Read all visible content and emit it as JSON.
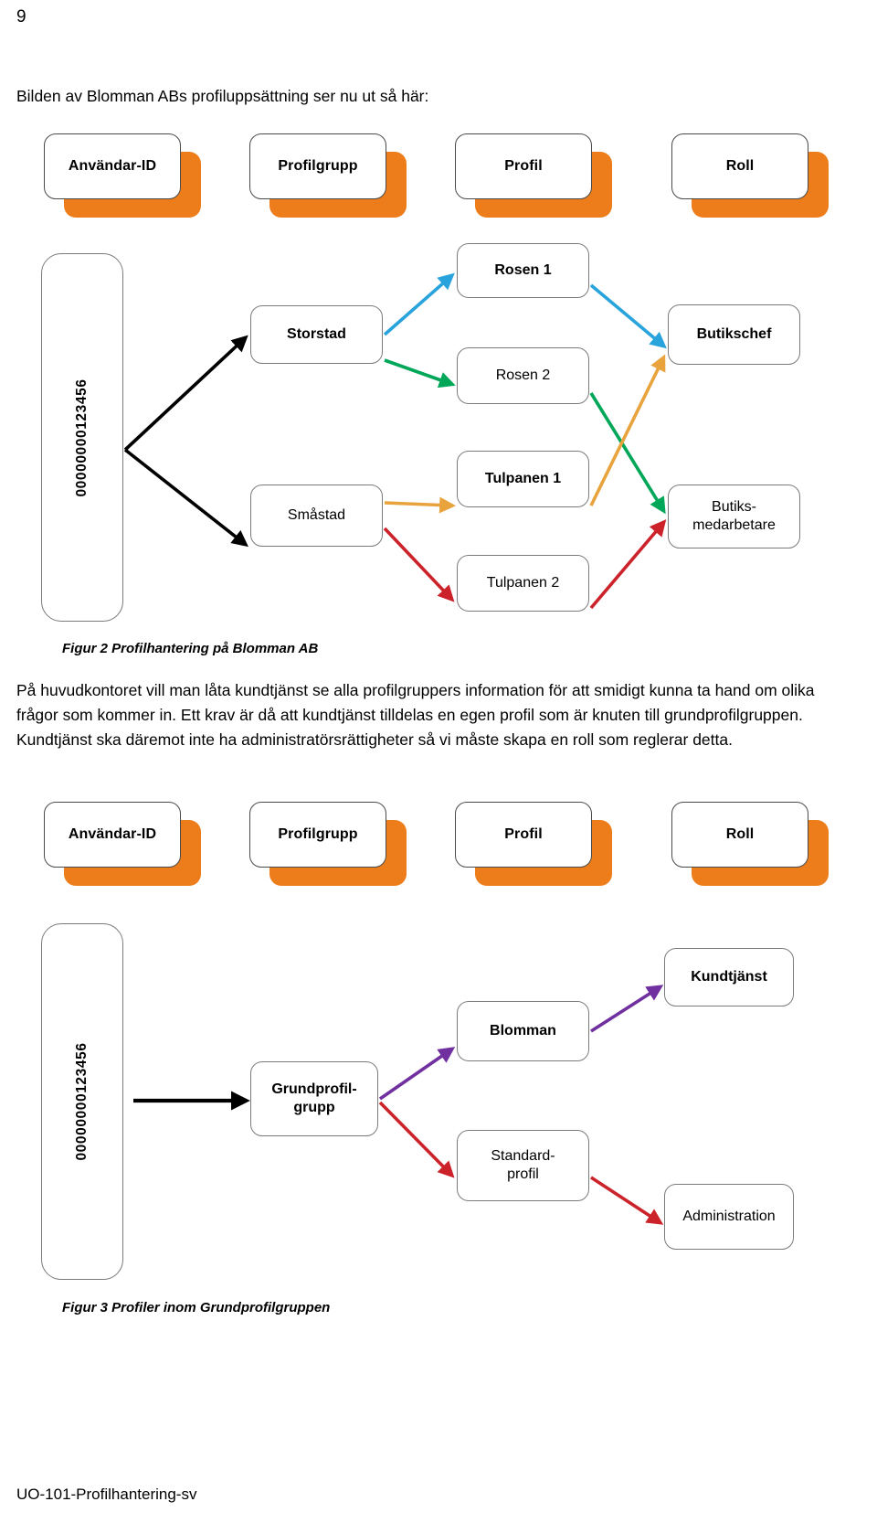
{
  "page_number": "9",
  "intro_text": "Bilden av Blomman ABs profiluppsättning ser nu ut så här:",
  "footer": "UO-101-Profilhantering-sv",
  "colors": {
    "orange_shadow": "#ED7D1A",
    "arrow_black": "#000000",
    "arrow_blue": "#29A3DC",
    "arrow_green": "#00A758",
    "arrow_amber": "#E8A33D",
    "arrow_red": "#CC2229",
    "arrow_purple": "#7030A0",
    "box_border": "#7B7B7B"
  },
  "column_headers_top": [
    {
      "label": "Användar-ID"
    },
    {
      "label": "Profilgrupp"
    },
    {
      "label": "Profil"
    },
    {
      "label": "Roll"
    }
  ],
  "figure2": {
    "caption": "Figur 2 Profilhantering på Blomman AB",
    "user_id": "00000000123456",
    "profile_groups": [
      {
        "label": "Storstad"
      },
      {
        "label": "Småstad"
      }
    ],
    "profiles": [
      {
        "label": "Rosen 1"
      },
      {
        "label": "Rosen 2"
      },
      {
        "label": "Tulpanen 1"
      },
      {
        "label": "Tulpanen 2"
      }
    ],
    "roles": [
      {
        "label": "Butikschef"
      },
      {
        "label": "Butiks-\nmedarbetare",
        "line1": "Butiks-",
        "line2": "medarbetare"
      }
    ]
  },
  "paragraph": "På huvudkontoret vill man låta kundtjänst se alla profilgruppers information för att smidigt kunna ta hand om olika frågor som kommer in. Ett krav är då att kundtjänst tilldelas en egen profil som är knuten till grundprofilgruppen. Kundtjänst ska däremot inte ha administratörsrättigheter så vi måste skapa en roll som reglerar detta.",
  "column_headers_bottom": [
    {
      "label": "Användar-ID"
    },
    {
      "label": "Profilgrupp"
    },
    {
      "label": "Profil"
    },
    {
      "label": "Roll"
    }
  ],
  "figure3": {
    "caption": "Figur 3 Profiler inom Grundprofilgruppen",
    "user_id": "00000000123456",
    "profile_group": {
      "line1": "Grundprofil-",
      "line2": "grupp"
    },
    "profiles": [
      {
        "label": "Blomman"
      },
      {
        "line1": "Standard-",
        "line2": "profil"
      }
    ],
    "roles": [
      {
        "label": "Kundtjänst"
      },
      {
        "label": "Administration"
      }
    ]
  }
}
